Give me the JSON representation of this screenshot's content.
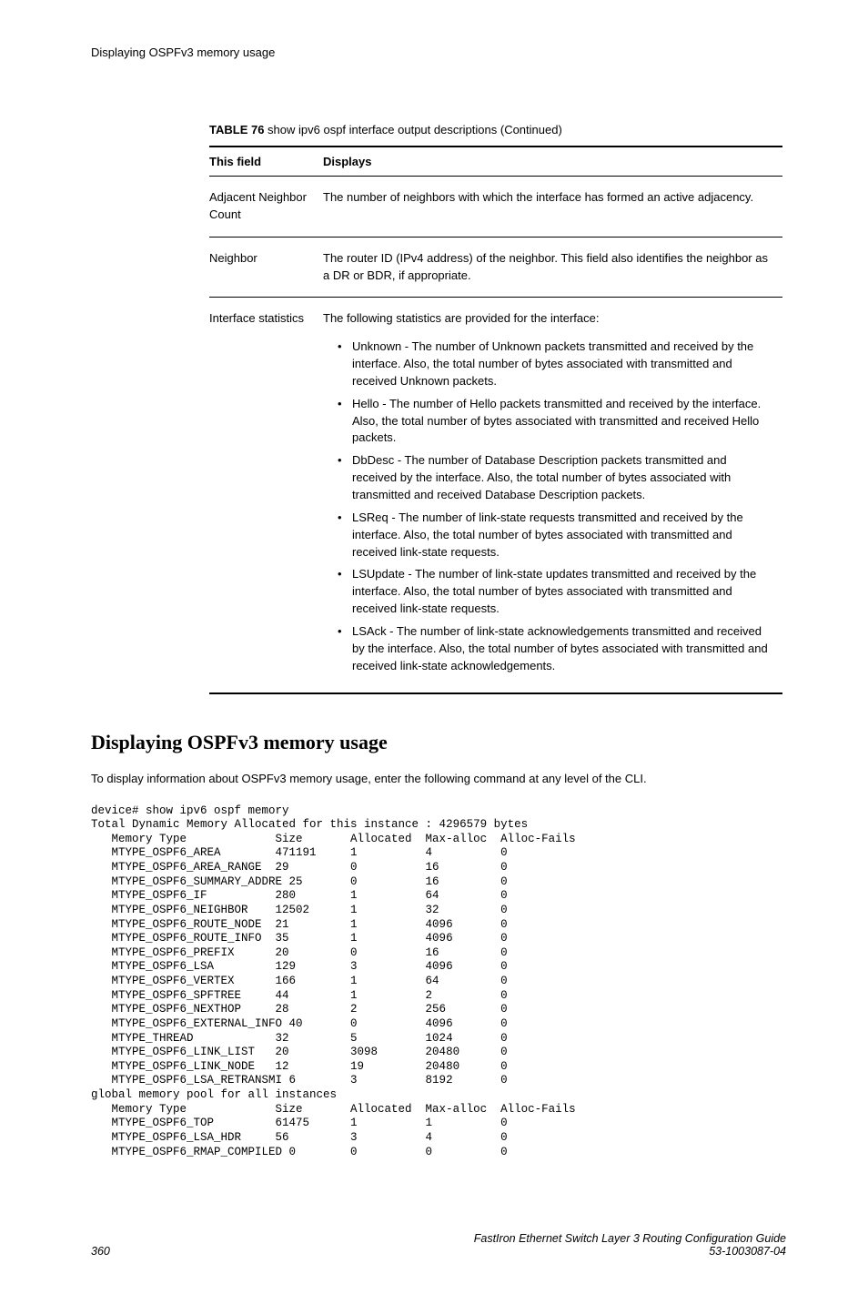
{
  "header": {
    "title": "Displaying OSPFv3 memory usage"
  },
  "table": {
    "caption_label": "TABLE 76",
    "caption_text": " show ipv6 ospf interface output descriptions (Continued)",
    "col1": "This field",
    "col2": "Displays",
    "rows": [
      {
        "field": "Adjacent Neighbor Count",
        "desc": "The number of neighbors with which the interface has formed an active adjacency."
      },
      {
        "field": "Neighbor",
        "desc": "The router ID (IPv4 address) of the neighbor. This field also identifies the neighbor as a DR or BDR, if appropriate."
      },
      {
        "field": "Interface statistics",
        "desc": "The following statistics are provided for the interface:",
        "bullets": [
          "Unknown - The number of Unknown packets transmitted and received by the interface. Also, the total number of bytes associated with transmitted and received Unknown packets.",
          "Hello - The number of Hello packets transmitted and received by the interface. Also, the total number of bytes associated with transmitted and received Hello packets.",
          "DbDesc - The number of Database Description packets transmitted and received by the interface. Also, the total number of bytes associated with transmitted and received Database Description packets.",
          "LSReq - The number of link-state requests transmitted and received by the interface. Also, the total number of bytes associated with transmitted and received link-state requests.",
          "LSUpdate - The number of link-state updates transmitted and received by the interface. Also, the total number of bytes associated with transmitted and received link-state requests.",
          "LSAck - The number of link-state acknowledgements transmitted and received by the interface. Also, the total number of bytes associated with transmitted and received link-state acknowledgements."
        ]
      }
    ]
  },
  "section": {
    "heading": "Displaying OSPFv3 memory usage",
    "intro": "To display information about OSPFv3 memory usage, enter the following command at any level of the CLI."
  },
  "cli": {
    "lines": [
      "device# show ipv6 ospf memory",
      "Total Dynamic Memory Allocated for this instance : 4296579 bytes",
      "   Memory Type             Size       Allocated  Max-alloc  Alloc-Fails",
      "   MTYPE_OSPF6_AREA        471191     1          4          0",
      "   MTYPE_OSPF6_AREA_RANGE  29         0          16         0",
      "   MTYPE_OSPF6_SUMMARY_ADDRE 25       0          16         0",
      "   MTYPE_OSPF6_IF          280        1          64         0",
      "   MTYPE_OSPF6_NEIGHBOR    12502      1          32         0",
      "   MTYPE_OSPF6_ROUTE_NODE  21         1          4096       0",
      "   MTYPE_OSPF6_ROUTE_INFO  35         1          4096       0",
      "   MTYPE_OSPF6_PREFIX      20         0          16         0",
      "   MTYPE_OSPF6_LSA         129        3          4096       0",
      "   MTYPE_OSPF6_VERTEX      166        1          64         0",
      "   MTYPE_OSPF6_SPFTREE     44         1          2          0",
      "   MTYPE_OSPF6_NEXTHOP     28         2          256        0",
      "   MTYPE_OSPF6_EXTERNAL_INFO 40       0          4096       0",
      "   MTYPE_THREAD            32         5          1024       0",
      "   MTYPE_OSPF6_LINK_LIST   20         3098       20480      0",
      "   MTYPE_OSPF6_LINK_NODE   12         19         20480      0",
      "   MTYPE_OSPF6_LSA_RETRANSMI 6        3          8192       0",
      "global memory pool for all instances",
      "   Memory Type             Size       Allocated  Max-alloc  Alloc-Fails",
      "   MTYPE_OSPF6_TOP         61475      1          1          0",
      "   MTYPE_OSPF6_LSA_HDR     56         3          4          0",
      "   MTYPE_OSPF6_RMAP_COMPILED 0        0          0          0"
    ]
  },
  "footer": {
    "page": "360",
    "doc_title": "FastIron Ethernet Switch Layer 3 Routing Configuration Guide",
    "doc_number": "53-1003087-04"
  }
}
